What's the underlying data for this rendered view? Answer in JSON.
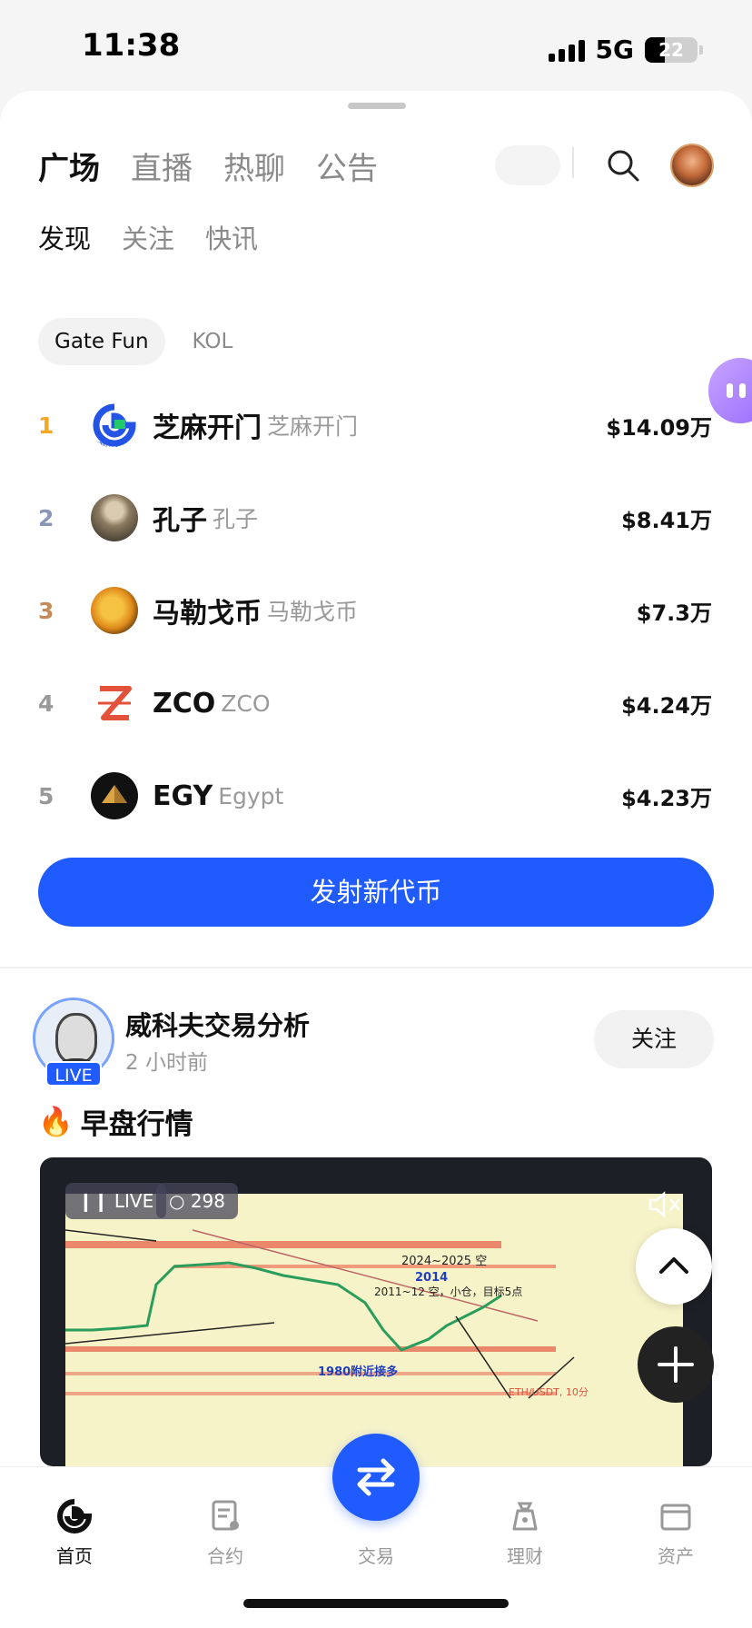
{
  "status_bar": {
    "time": "11:38",
    "network": "5G",
    "battery": "22"
  },
  "top_tabs": [
    {
      "label": "广场",
      "active": true
    },
    {
      "label": "直播",
      "active": false
    },
    {
      "label": "热聊",
      "active": false
    },
    {
      "label": "公告",
      "active": false
    }
  ],
  "sub_tabs": [
    {
      "label": "发现",
      "active": true
    },
    {
      "label": "关注",
      "active": false
    },
    {
      "label": "快讯",
      "active": false
    }
  ],
  "filters": [
    {
      "label": "Gate Fun",
      "active": true
    },
    {
      "label": "KOL",
      "active": false
    }
  ],
  "tokens": [
    {
      "rank": "1",
      "name": "芝麻开门",
      "sub": "芝麻开门",
      "value": "$14.09万",
      "rank_color": "#f5a623",
      "logo_caption": "芝麻开门"
    },
    {
      "rank": "2",
      "name": "孔子",
      "sub": "孔子",
      "value": "$8.41万",
      "rank_color": "#8a96b8"
    },
    {
      "rank": "3",
      "name": "马勒戈币",
      "sub": "马勒戈币",
      "value": "$7.3万",
      "rank_color": "#c48a5a"
    },
    {
      "rank": "4",
      "name": "ZCO",
      "sub": "ZCO",
      "value": "$4.24万",
      "rank_color": "#999999"
    },
    {
      "rank": "5",
      "name": "EGY",
      "sub": "Egypt",
      "value": "$4.23万",
      "rank_color": "#999999"
    }
  ],
  "launch_button": "发射新代币",
  "post": {
    "author": "威科夫交易分析",
    "time": "2 小时前",
    "live_badge": "LIVE",
    "follow": "关注",
    "title": "早盘行情",
    "live_chip": "LIVE",
    "views": "298",
    "chart_text": {
      "label1": "2024~2025 空",
      "label2": "2014",
      "label3": "2011~12 空，小仓，目标5点",
      "label4": "1980附近接多",
      "label5": "ETH/USDT, 10分"
    }
  },
  "bottom_nav": [
    {
      "label": "首页",
      "active": true
    },
    {
      "label": "合约",
      "active": false
    },
    {
      "label": "交易",
      "active": false
    },
    {
      "label": "理财",
      "active": false
    },
    {
      "label": "资产",
      "active": false
    }
  ],
  "colors": {
    "accent": "#1f5bff"
  }
}
